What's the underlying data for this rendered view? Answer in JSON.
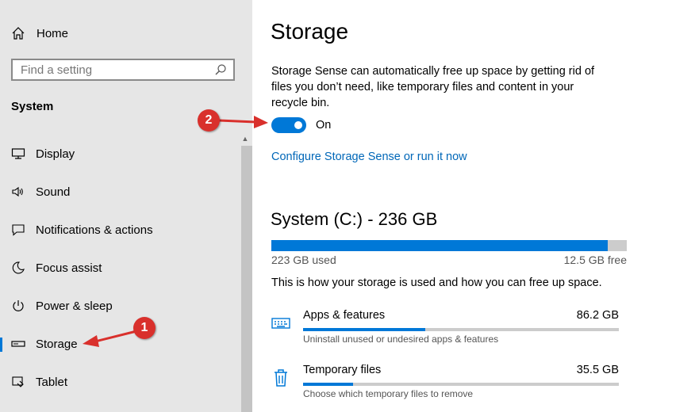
{
  "sidebar": {
    "home_label": "Home",
    "search_placeholder": "Find a setting",
    "section_title": "System",
    "items": [
      {
        "label": "Display",
        "icon": "monitor-icon"
      },
      {
        "label": "Sound",
        "icon": "speaker-icon"
      },
      {
        "label": "Notifications & actions",
        "icon": "message-icon"
      },
      {
        "label": "Focus assist",
        "icon": "moon-icon"
      },
      {
        "label": "Power & sleep",
        "icon": "power-icon"
      },
      {
        "label": "Storage",
        "icon": "drive-icon",
        "active": true
      },
      {
        "label": "Tablet",
        "icon": "tablet-icon"
      }
    ]
  },
  "main": {
    "title": "Storage",
    "description": "Storage Sense can automatically free up space by getting rid of files you don’t need, like temporary files and content in your recycle bin.",
    "toggle_state": "On",
    "configure_link": "Configure Storage Sense or run it now",
    "drive": {
      "title": "System (C:) - 236 GB",
      "used": "223 GB used",
      "free": "12.5 GB free",
      "used_fraction": 0.947
    },
    "usage_description": "This is how your storage is used and how you can free up space.",
    "categories": [
      {
        "name": "Apps & features",
        "size": "86.2 GB",
        "description": "Uninstall unused or undesired apps & features",
        "fraction": 0.386,
        "icon": "keyboard-icon"
      },
      {
        "name": "Temporary files",
        "size": "35.5 GB",
        "description": "Choose which temporary files to remove",
        "fraction": 0.159,
        "icon": "trash-icon"
      }
    ]
  },
  "annotations": {
    "badge_1": "1",
    "badge_2": "2"
  },
  "colors": {
    "accent": "#0078d7",
    "sidebar_bg": "#e6e6e6",
    "annotation_red": "#d9302c"
  }
}
